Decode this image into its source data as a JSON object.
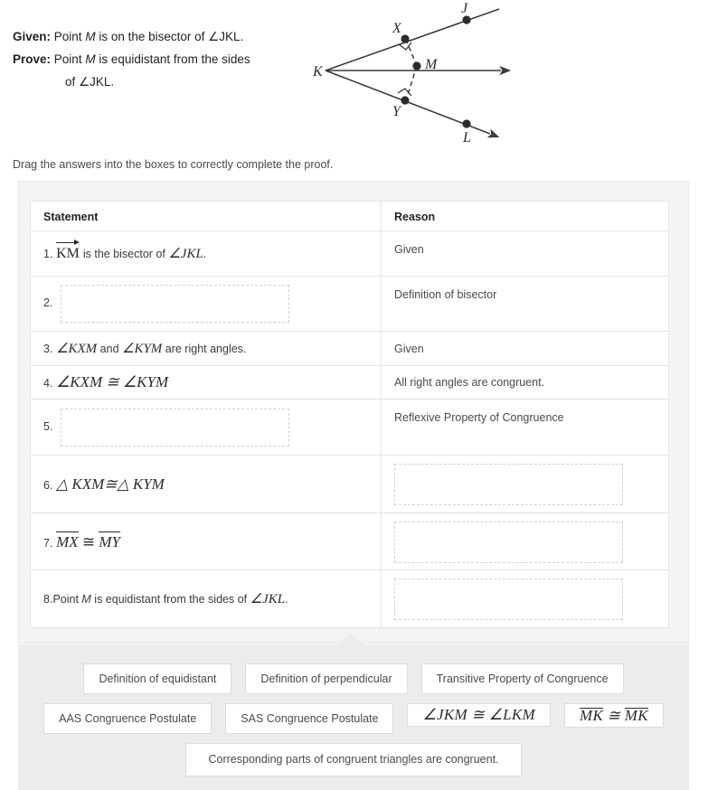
{
  "problem": {
    "given_label": "Given:",
    "given_text_a": "Point ",
    "given_point": "M",
    "given_text_b": " is on the bisector of ",
    "given_angle": "∠JKL",
    "given_period": ".",
    "prove_label": "Prove:",
    "prove_text_a": "Point ",
    "prove_point": "M",
    "prove_text_b": " is equidistant from the sides",
    "prove_text_c": "of ",
    "prove_angle": "∠JKL",
    "prove_period": "."
  },
  "figure": {
    "labels": {
      "J": "J",
      "K": "K",
      "L": "L",
      "M": "M",
      "X": "X",
      "Y": "Y"
    },
    "stroke_color": "#3a3a3a",
    "dashed_color": "#3a3a3a"
  },
  "instruction": "Drag the answers into the boxes to correctly complete the proof.",
  "table": {
    "headers": {
      "statement": "Statement",
      "reason": "Reason"
    },
    "rows": [
      {
        "num": "1.",
        "statement_type": "math_ray",
        "ray_text": "KM",
        "statement_tail": " is the bisector of ",
        "statement_angle": "∠JKL",
        "statement_period": ".",
        "reason": "Given",
        "reason_empty": false
      },
      {
        "num": "2.",
        "statement_type": "dropzone",
        "reason": "Definition of bisector",
        "reason_empty": false
      },
      {
        "num": "3.",
        "statement_type": "mixed_angles",
        "angle_a": "∠KXM",
        "mid_text": " and ",
        "angle_b": "∠KYM",
        "tail_text": " are right angles.",
        "reason": "Given",
        "reason_empty": false
      },
      {
        "num": "4.",
        "statement_type": "math",
        "math_text": "∠KXM ≅ ∠KYM",
        "reason": "All right angles are congruent.",
        "reason_empty": false
      },
      {
        "num": "5.",
        "statement_type": "dropzone",
        "reason": "Reflexive Property of Congruence",
        "reason_empty": false
      },
      {
        "num": "6.",
        "statement_type": "triangles",
        "tri_a": "△ KXM",
        "tri_cong": "≅",
        "tri_b": "△ KYM",
        "reason": "",
        "reason_empty": true
      },
      {
        "num": "7.",
        "statement_type": "segments",
        "seg_a": "MX",
        "seg_cong": " ≅ ",
        "seg_b": "MY",
        "reason": "",
        "reason_empty": true
      },
      {
        "num": "8.",
        "statement_type": "point_text",
        "text_a": "Point ",
        "point": "M",
        "text_b": " is equidistant from the sides of ",
        "statement_angle": "∠JKL",
        "statement_period": ".",
        "reason": "",
        "reason_empty": true
      }
    ]
  },
  "answer_tiles": {
    "row1": [
      {
        "label": "Definition of equidistant",
        "math": false
      },
      {
        "label": "Definition of perpendicular",
        "math": false
      },
      {
        "label": "Transitive Property of Congruence",
        "math": false
      }
    ],
    "row2": [
      {
        "label": "AAS Congruence Postulate",
        "math": false
      },
      {
        "label": "SAS Congruence Postulate",
        "math": false
      },
      {
        "label": "∠JKM ≅ ∠LKM",
        "math": true
      },
      {
        "label": "MK ≅ MK",
        "math": true,
        "segments": true,
        "seg_a": "MK",
        "seg_mid": " ≅ ",
        "seg_b": "MK"
      }
    ],
    "row3": [
      {
        "label": "Corresponding parts of congruent triangles are congruent.",
        "math": false,
        "wide": true
      }
    ]
  },
  "colors": {
    "page_background": "#ffffff",
    "card_background": "#f4f4f4",
    "tray_background": "#ececec",
    "table_border": "#e3e3e3",
    "dropzone_border": "#d2d2d2",
    "tile_border": "#dcdcdc",
    "text": "#3a3a3a"
  }
}
